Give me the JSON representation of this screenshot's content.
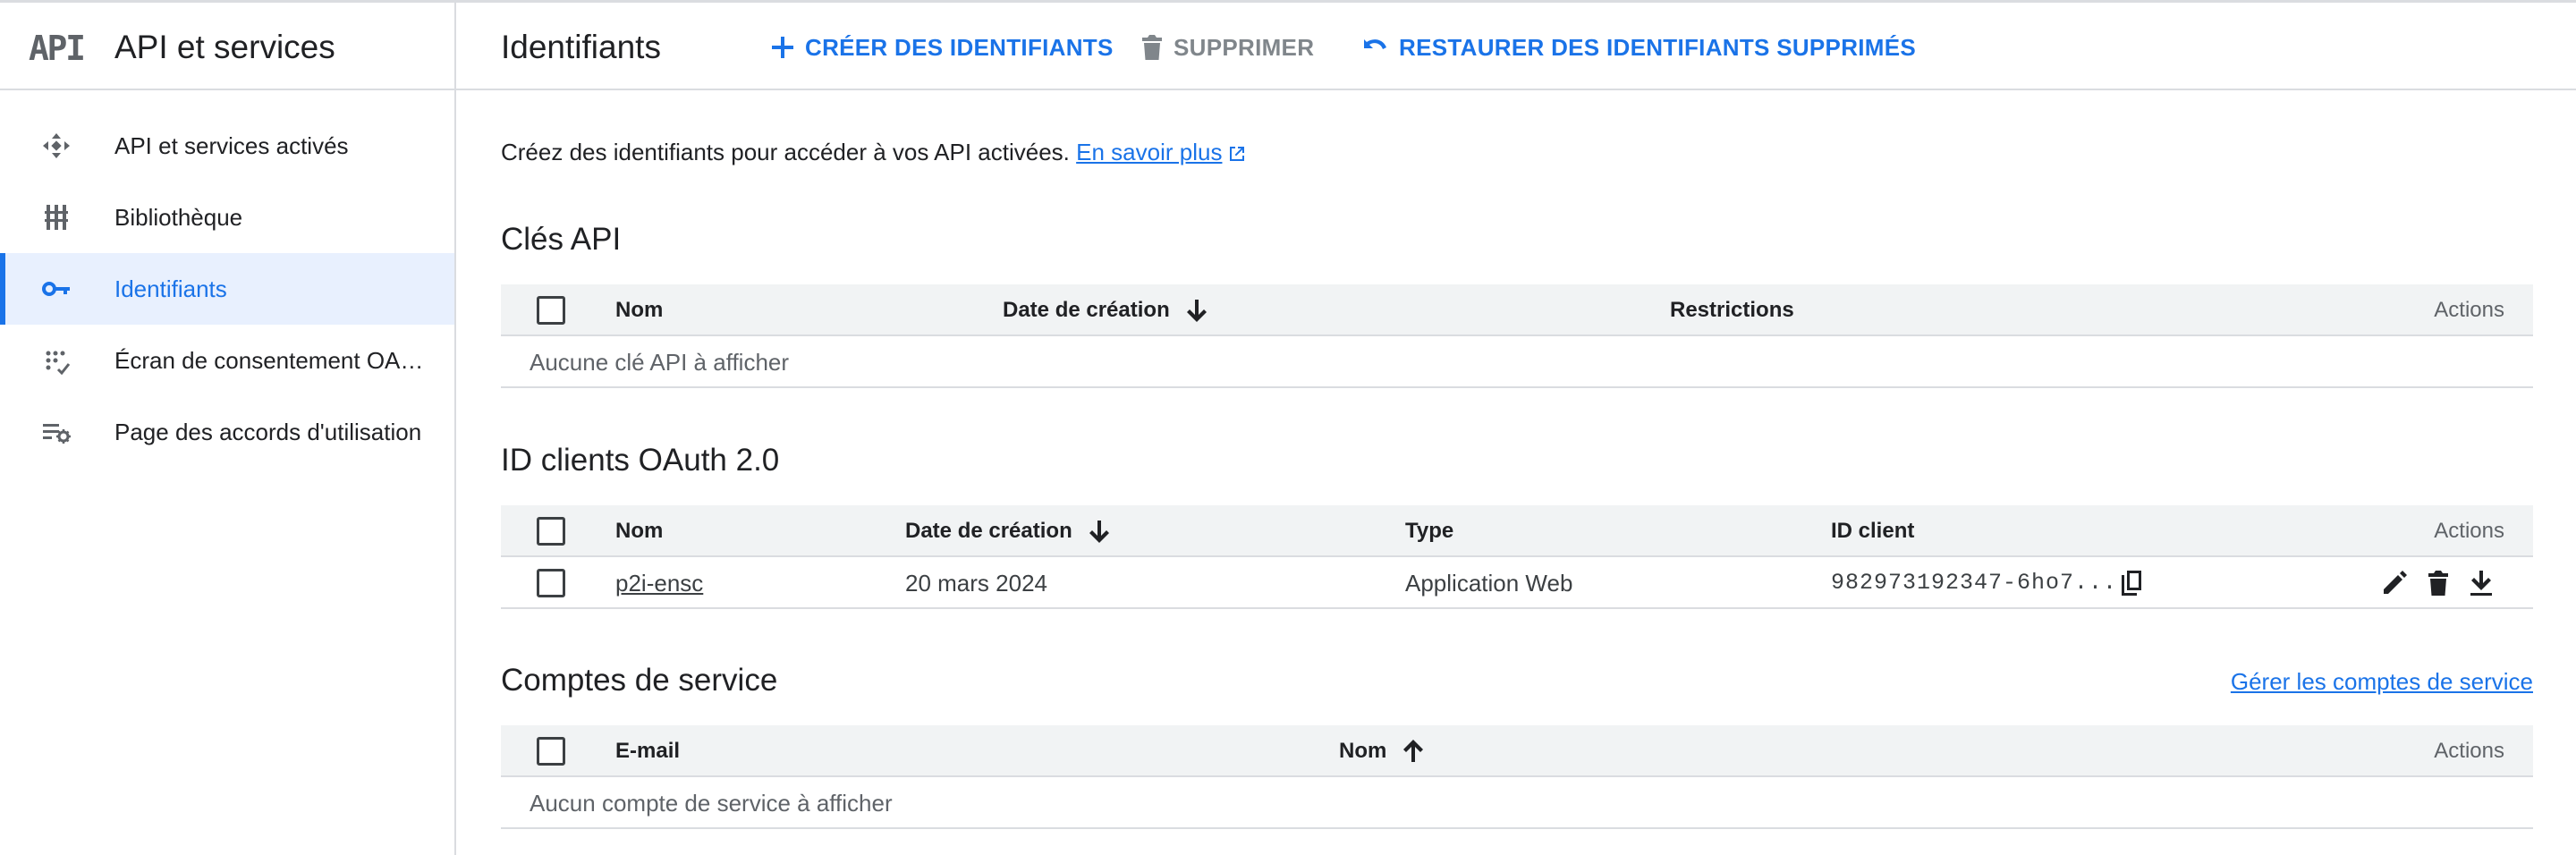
{
  "sidebar": {
    "logo_text": "API",
    "title": "API et services",
    "items": [
      {
        "label": "API et services activés",
        "icon": "enabled-apis-icon",
        "active": false
      },
      {
        "label": "Bibliothèque",
        "icon": "library-icon",
        "active": false
      },
      {
        "label": "Identifiants",
        "icon": "key-icon",
        "active": true
      },
      {
        "label": "Écran de consentement OAuth",
        "icon": "consent-screen-icon",
        "active": false
      },
      {
        "label": "Page des accords d'utilisation",
        "icon": "agreements-icon",
        "active": false
      }
    ]
  },
  "toolbar": {
    "page_title": "Identifiants",
    "create_label": "CRÉER DES IDENTIFIANTS",
    "delete_label": "SUPPRIMER",
    "restore_label": "RESTAURER DES IDENTIFIANTS SUPPRIMÉS"
  },
  "intro": {
    "text": "Créez des identifiants pour accéder à vos API activées.",
    "link_label": "En savoir plus"
  },
  "api_keys": {
    "title": "Clés API",
    "columns": [
      "Nom",
      "Date de création",
      "Restrictions",
      "Actions"
    ],
    "sort_direction": "descending",
    "empty_text": "Aucune clé API à afficher"
  },
  "oauth": {
    "title": "ID clients OAuth 2.0",
    "columns": [
      "Nom",
      "Date de création",
      "Type",
      "ID client",
      "Actions"
    ],
    "sort_direction": "descending",
    "rows": [
      {
        "name": "p2i-ensc",
        "created": "20 mars 2024",
        "type": "Application Web",
        "client_id": "982973192347-6ho7..."
      }
    ]
  },
  "service_accounts": {
    "title": "Comptes de service",
    "manage_link": "Gérer les comptes de service",
    "columns": [
      "E-mail",
      "Nom",
      "Actions"
    ],
    "sort_direction": "ascending",
    "empty_text": "Aucun compte de service à afficher"
  },
  "colors": {
    "accent": "#1a73e8",
    "active_bg": "#e8f0fe",
    "table_header_bg": "#f1f3f4",
    "divider": "#dadce0",
    "muted": "#80868b"
  }
}
